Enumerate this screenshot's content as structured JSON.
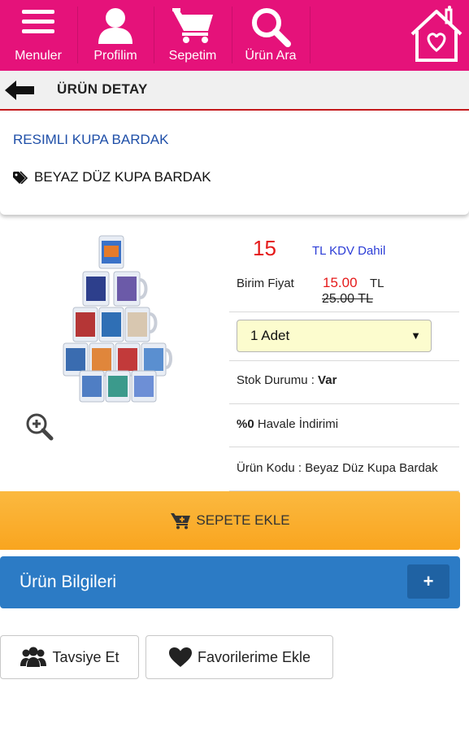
{
  "nav": {
    "menu_label": "Menuler",
    "profile_label": "Profilim",
    "cart_label": "Sepetim",
    "search_label": "Ürün Ara",
    "color": "#e5127a"
  },
  "subheader": {
    "title": "ÜRÜN DETAY"
  },
  "product": {
    "category": "RESIMLI KUPA BARDAK",
    "name": "BEYAZ DÜZ KUPA BARDAK",
    "price": "15",
    "price_note": "TL KDV Dahil",
    "unit_price_label": "Birim Fiyat",
    "unit_price": "15.00",
    "unit_currency": "TL",
    "old_price": "25.00  TL",
    "quantity_selected": "1 Adet",
    "stock_label": "Stok Durumu :",
    "stock_value": "Var",
    "discount_value": "%0",
    "discount_label": "Havale İndirimi",
    "code_label": "Ürün Kodu :",
    "code_value": "Beyaz Düz Kupa Bardak"
  },
  "actions": {
    "add_to_cart": "SEPETE EKLE",
    "product_info": "Ürün Bilgileri",
    "expand": "+",
    "recommend": "Tavsiye Et",
    "add_favorites": "Favorilerime Ekle"
  },
  "colors": {
    "brand_pink": "#e5127a",
    "price_red": "#e51a1a",
    "link_blue": "#1f4fa8",
    "cart_orange": "#f9a51f",
    "info_blue": "#2c7bc5"
  }
}
